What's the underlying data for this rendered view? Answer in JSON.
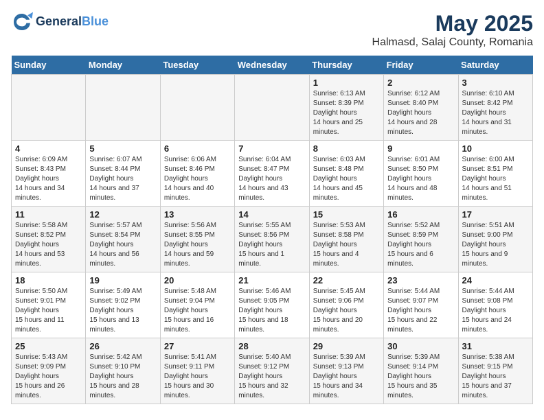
{
  "header": {
    "logo_line1": "General",
    "logo_line2": "Blue",
    "title": "May 2025",
    "subtitle": "Halmasd, Salaj County, Romania"
  },
  "weekdays": [
    "Sunday",
    "Monday",
    "Tuesday",
    "Wednesday",
    "Thursday",
    "Friday",
    "Saturday"
  ],
  "weeks": [
    [
      {
        "day": "",
        "sunrise": "",
        "sunset": "",
        "daylight": ""
      },
      {
        "day": "",
        "sunrise": "",
        "sunset": "",
        "daylight": ""
      },
      {
        "day": "",
        "sunrise": "",
        "sunset": "",
        "daylight": ""
      },
      {
        "day": "",
        "sunrise": "",
        "sunset": "",
        "daylight": ""
      },
      {
        "day": "1",
        "sunrise": "6:13 AM",
        "sunset": "8:39 PM",
        "daylight": "14 hours and 25 minutes."
      },
      {
        "day": "2",
        "sunrise": "6:12 AM",
        "sunset": "8:40 PM",
        "daylight": "14 hours and 28 minutes."
      },
      {
        "day": "3",
        "sunrise": "6:10 AM",
        "sunset": "8:42 PM",
        "daylight": "14 hours and 31 minutes."
      }
    ],
    [
      {
        "day": "4",
        "sunrise": "6:09 AM",
        "sunset": "8:43 PM",
        "daylight": "14 hours and 34 minutes."
      },
      {
        "day": "5",
        "sunrise": "6:07 AM",
        "sunset": "8:44 PM",
        "daylight": "14 hours and 37 minutes."
      },
      {
        "day": "6",
        "sunrise": "6:06 AM",
        "sunset": "8:46 PM",
        "daylight": "14 hours and 40 minutes."
      },
      {
        "day": "7",
        "sunrise": "6:04 AM",
        "sunset": "8:47 PM",
        "daylight": "14 hours and 43 minutes."
      },
      {
        "day": "8",
        "sunrise": "6:03 AM",
        "sunset": "8:48 PM",
        "daylight": "14 hours and 45 minutes."
      },
      {
        "day": "9",
        "sunrise": "6:01 AM",
        "sunset": "8:50 PM",
        "daylight": "14 hours and 48 minutes."
      },
      {
        "day": "10",
        "sunrise": "6:00 AM",
        "sunset": "8:51 PM",
        "daylight": "14 hours and 51 minutes."
      }
    ],
    [
      {
        "day": "11",
        "sunrise": "5:58 AM",
        "sunset": "8:52 PM",
        "daylight": "14 hours and 53 minutes."
      },
      {
        "day": "12",
        "sunrise": "5:57 AM",
        "sunset": "8:54 PM",
        "daylight": "14 hours and 56 minutes."
      },
      {
        "day": "13",
        "sunrise": "5:56 AM",
        "sunset": "8:55 PM",
        "daylight": "14 hours and 59 minutes."
      },
      {
        "day": "14",
        "sunrise": "5:55 AM",
        "sunset": "8:56 PM",
        "daylight": "15 hours and 1 minute."
      },
      {
        "day": "15",
        "sunrise": "5:53 AM",
        "sunset": "8:58 PM",
        "daylight": "15 hours and 4 minutes."
      },
      {
        "day": "16",
        "sunrise": "5:52 AM",
        "sunset": "8:59 PM",
        "daylight": "15 hours and 6 minutes."
      },
      {
        "day": "17",
        "sunrise": "5:51 AM",
        "sunset": "9:00 PM",
        "daylight": "15 hours and 9 minutes."
      }
    ],
    [
      {
        "day": "18",
        "sunrise": "5:50 AM",
        "sunset": "9:01 PM",
        "daylight": "15 hours and 11 minutes."
      },
      {
        "day": "19",
        "sunrise": "5:49 AM",
        "sunset": "9:02 PM",
        "daylight": "15 hours and 13 minutes."
      },
      {
        "day": "20",
        "sunrise": "5:48 AM",
        "sunset": "9:04 PM",
        "daylight": "15 hours and 16 minutes."
      },
      {
        "day": "21",
        "sunrise": "5:46 AM",
        "sunset": "9:05 PM",
        "daylight": "15 hours and 18 minutes."
      },
      {
        "day": "22",
        "sunrise": "5:45 AM",
        "sunset": "9:06 PM",
        "daylight": "15 hours and 20 minutes."
      },
      {
        "day": "23",
        "sunrise": "5:44 AM",
        "sunset": "9:07 PM",
        "daylight": "15 hours and 22 minutes."
      },
      {
        "day": "24",
        "sunrise": "5:44 AM",
        "sunset": "9:08 PM",
        "daylight": "15 hours and 24 minutes."
      }
    ],
    [
      {
        "day": "25",
        "sunrise": "5:43 AM",
        "sunset": "9:09 PM",
        "daylight": "15 hours and 26 minutes."
      },
      {
        "day": "26",
        "sunrise": "5:42 AM",
        "sunset": "9:10 PM",
        "daylight": "15 hours and 28 minutes."
      },
      {
        "day": "27",
        "sunrise": "5:41 AM",
        "sunset": "9:11 PM",
        "daylight": "15 hours and 30 minutes."
      },
      {
        "day": "28",
        "sunrise": "5:40 AM",
        "sunset": "9:12 PM",
        "daylight": "15 hours and 32 minutes."
      },
      {
        "day": "29",
        "sunrise": "5:39 AM",
        "sunset": "9:13 PM",
        "daylight": "15 hours and 34 minutes."
      },
      {
        "day": "30",
        "sunrise": "5:39 AM",
        "sunset": "9:14 PM",
        "daylight": "15 hours and 35 minutes."
      },
      {
        "day": "31",
        "sunrise": "5:38 AM",
        "sunset": "9:15 PM",
        "daylight": "15 hours and 37 minutes."
      }
    ]
  ]
}
